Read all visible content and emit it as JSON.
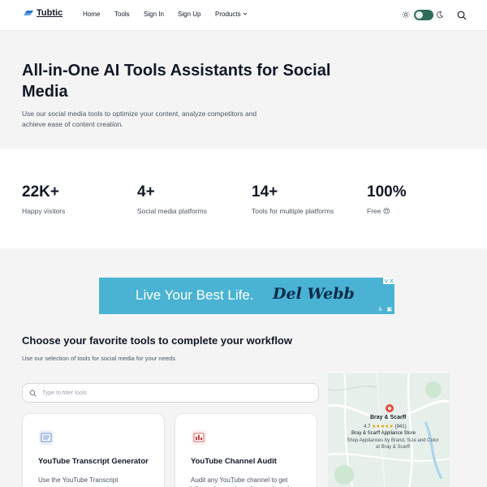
{
  "header": {
    "logo_text": "Tubtic",
    "nav": {
      "home": "Home",
      "tools": "Tools",
      "sign_in": "Sign In",
      "sign_up": "Sign Up",
      "products": "Products"
    },
    "theme_toggle_on": true
  },
  "hero": {
    "title": "All-in-One AI Tools Assistants for Social Media",
    "subtitle": "Use our social media tools to optimize your content, analyze competitors and achieve ease of content creation."
  },
  "stats": [
    {
      "value": "22K+",
      "label": "Happy visitors"
    },
    {
      "value": "4+",
      "label": "Social media platforms"
    },
    {
      "value": "14+",
      "label": "Tools for multiple platforms"
    },
    {
      "value": "100%",
      "label": "Free 😍"
    }
  ],
  "ad": {
    "text": "Live Your Best Life.",
    "brand": "Del Webb"
  },
  "tools_section": {
    "title": "Choose your favorite tools to complete your workflow",
    "subtitle": "Use our selection of tools for social media for your needs.",
    "filter_placeholder": "Type to filter tools",
    "cards": [
      {
        "title": "YouTube Transcript Generator",
        "description": "Use the YouTube Transcript",
        "icon": "transcript-icon"
      },
      {
        "title": "YouTube Channel Audit",
        "description": "Audit any YouTube channel to get information such as the number of",
        "icon": "channel-audit-icon"
      }
    ]
  },
  "map_ad": {
    "business": "Bray & Scarff",
    "rating": "4.7",
    "stars": "★★★★★",
    "reviews": "(941)",
    "store": "Bray & Scarff Appliance Store",
    "description": "Shop Appliances by Brand, Size and Color at Bray & Scarff"
  },
  "colors": {
    "accent": "#2f6b5a",
    "ad_background": "#4ab3d4",
    "page_background": "#f4f4f5"
  }
}
